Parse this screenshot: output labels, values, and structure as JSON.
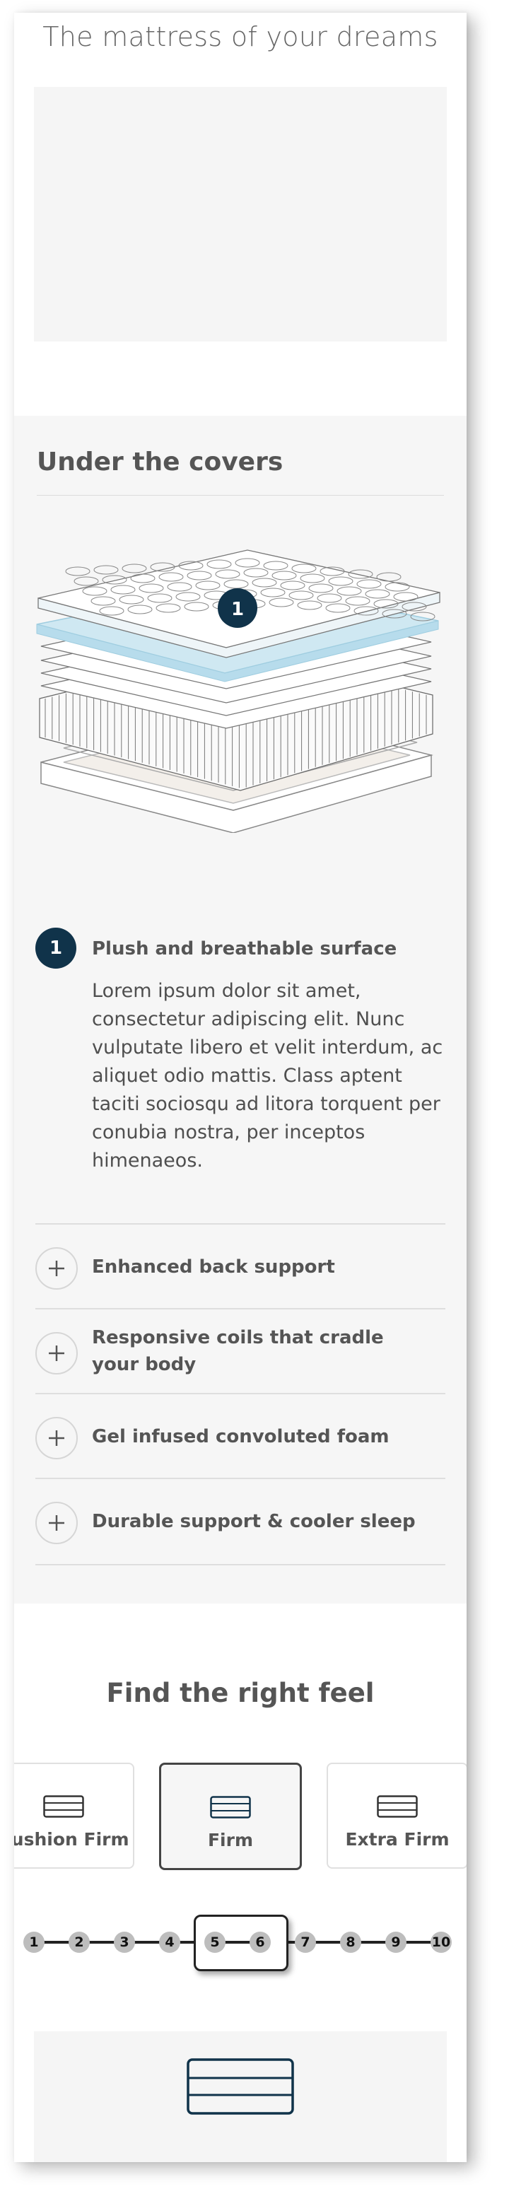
{
  "hero": {
    "title": "The mattress of your dreams"
  },
  "covers": {
    "title": "Under the covers",
    "active_feature": {
      "number": "1",
      "title": "Plush and breathable surface",
      "description": "Lorem ipsum dolor sit amet, consectetur adipiscing elit. Nunc vulputate libero et velit interdum, ac aliquet odio mattis. Class aptent taciti sociosqu ad litora torquent per conubia nostra, per inceptos himenaeos."
    },
    "illustration_marker": "1",
    "accordion": [
      {
        "label": "Enhanced back support",
        "icon": "plus-icon"
      },
      {
        "label": "Responsive coils that cradle your body",
        "icon": "plus-icon"
      },
      {
        "label": "Gel infused convoluted foam",
        "icon": "plus-icon"
      },
      {
        "label": "Durable support & cooler sleep",
        "icon": "plus-icon"
      }
    ]
  },
  "feel": {
    "title": "Find the right feel",
    "options": [
      {
        "label": "Cushion Firm",
        "icon": "mattress-icon"
      },
      {
        "label": "Firm",
        "icon": "mattress-icon",
        "selected": true
      },
      {
        "label": "Extra Firm",
        "icon": "mattress-icon"
      }
    ],
    "scale": [
      "1",
      "2",
      "3",
      "4",
      "5",
      "6",
      "7",
      "8",
      "9",
      "10"
    ],
    "scale_selected": [
      "5",
      "6"
    ]
  },
  "colors": {
    "badge": "#10334a",
    "section_bg": "#f6f6f6",
    "text": "#555555"
  }
}
